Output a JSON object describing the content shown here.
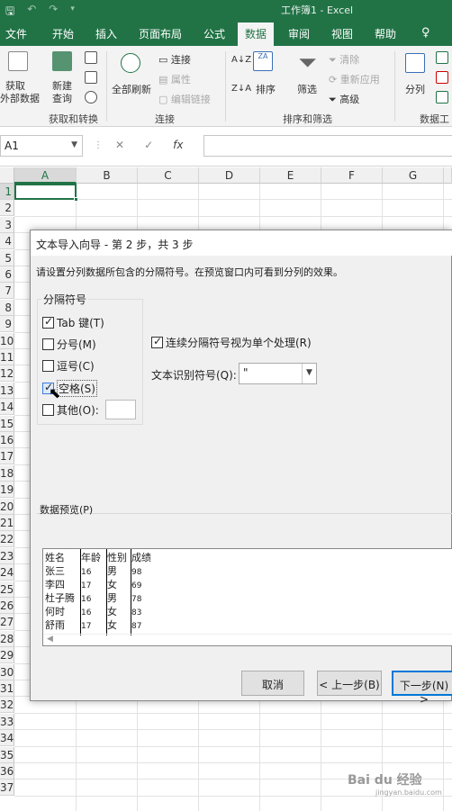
{
  "titlebar": {
    "title": "工作簿1  -  Excel",
    "save": "🖫",
    "undo": "↶",
    "redo": "↷",
    "more": "▾"
  },
  "tabs": [
    "文件",
    "开始",
    "插入",
    "页面布局",
    "公式",
    "数据",
    "审阅",
    "视图",
    "帮助"
  ],
  "tabs_active": "数据",
  "tell_me": "♀",
  "ribbon": {
    "get_data": "获取",
    "get_data2": "外部数据",
    "new_query": "新建",
    "new_query2": "查询",
    "refresh_all": "全部刷新",
    "connections": "连接",
    "properties": "属性",
    "edit_links": "编辑链接",
    "sort": "排序",
    "filter": "筛选",
    "clear": "清除",
    "reapply": "重新应用",
    "advanced": "高级",
    "text_to_columns": "分列",
    "group_get": "获取和转换",
    "group_conn": "连接",
    "group_sort": "排序和筛选",
    "group_tools": "数据工"
  },
  "formula_bar": {
    "name_box": "A1",
    "cancel": "✕",
    "enter": "✓",
    "fx": "fx"
  },
  "grid": {
    "columns": [
      "A",
      "B",
      "C",
      "D",
      "E",
      "F",
      "G"
    ],
    "rows": [
      "1",
      "2",
      "3",
      "4",
      "5",
      "6",
      "7",
      "8",
      "9",
      "10",
      "11",
      "12",
      "13",
      "14",
      "15",
      "16",
      "17",
      "18",
      "19",
      "20",
      "21",
      "22",
      "23",
      "24",
      "25",
      "26",
      "27",
      "28",
      "29",
      "30",
      "31",
      "32",
      "33",
      "34",
      "35",
      "36",
      "37"
    ]
  },
  "dialog": {
    "title": "文本导入向导 - 第 2 步，共 3 步",
    "instruction": "请设置分列数据所包含的分隔符号。在预览窗口内可看到分列的效果。",
    "delimiters_group": "分隔符号",
    "tab_label": "Tab 键(T)",
    "semicolon_label": "分号(M)",
    "comma_label": "逗号(C)",
    "space_label": "空格(S)",
    "other_label": "其他(O):",
    "consecutive_label": "连续分隔符号视为单个处理(R)",
    "qualifier_label": "文本识别符号(Q):",
    "qualifier_value": "\"",
    "preview_label": "数据预览(P)",
    "preview_rows": [
      [
        "姓名",
        "年龄",
        "性别",
        "成绩"
      ],
      [
        "张三",
        "16",
        "男",
        "98"
      ],
      [
        "李四",
        "17",
        "女",
        "69"
      ],
      [
        "杜子腾",
        "16",
        "男",
        "78"
      ],
      [
        "何时",
        "16",
        "女",
        "83"
      ],
      [
        "舒雨",
        "17",
        "女",
        "87"
      ]
    ],
    "cancel_button": "取消",
    "back_button": "< 上一步(B)",
    "next_button": "下一步(N) >"
  },
  "checkboxes": {
    "tab": true,
    "semicolon": false,
    "comma": false,
    "space": true,
    "other": false,
    "consecutive": true
  },
  "watermark": {
    "main": "Bai du 经验",
    "sub": "jingyan.baidu.com"
  },
  "colors": {
    "excel_green": "#217346",
    "ribbon_bg": "#f3f3f3",
    "dialog_bg": "#f0f0f0"
  }
}
